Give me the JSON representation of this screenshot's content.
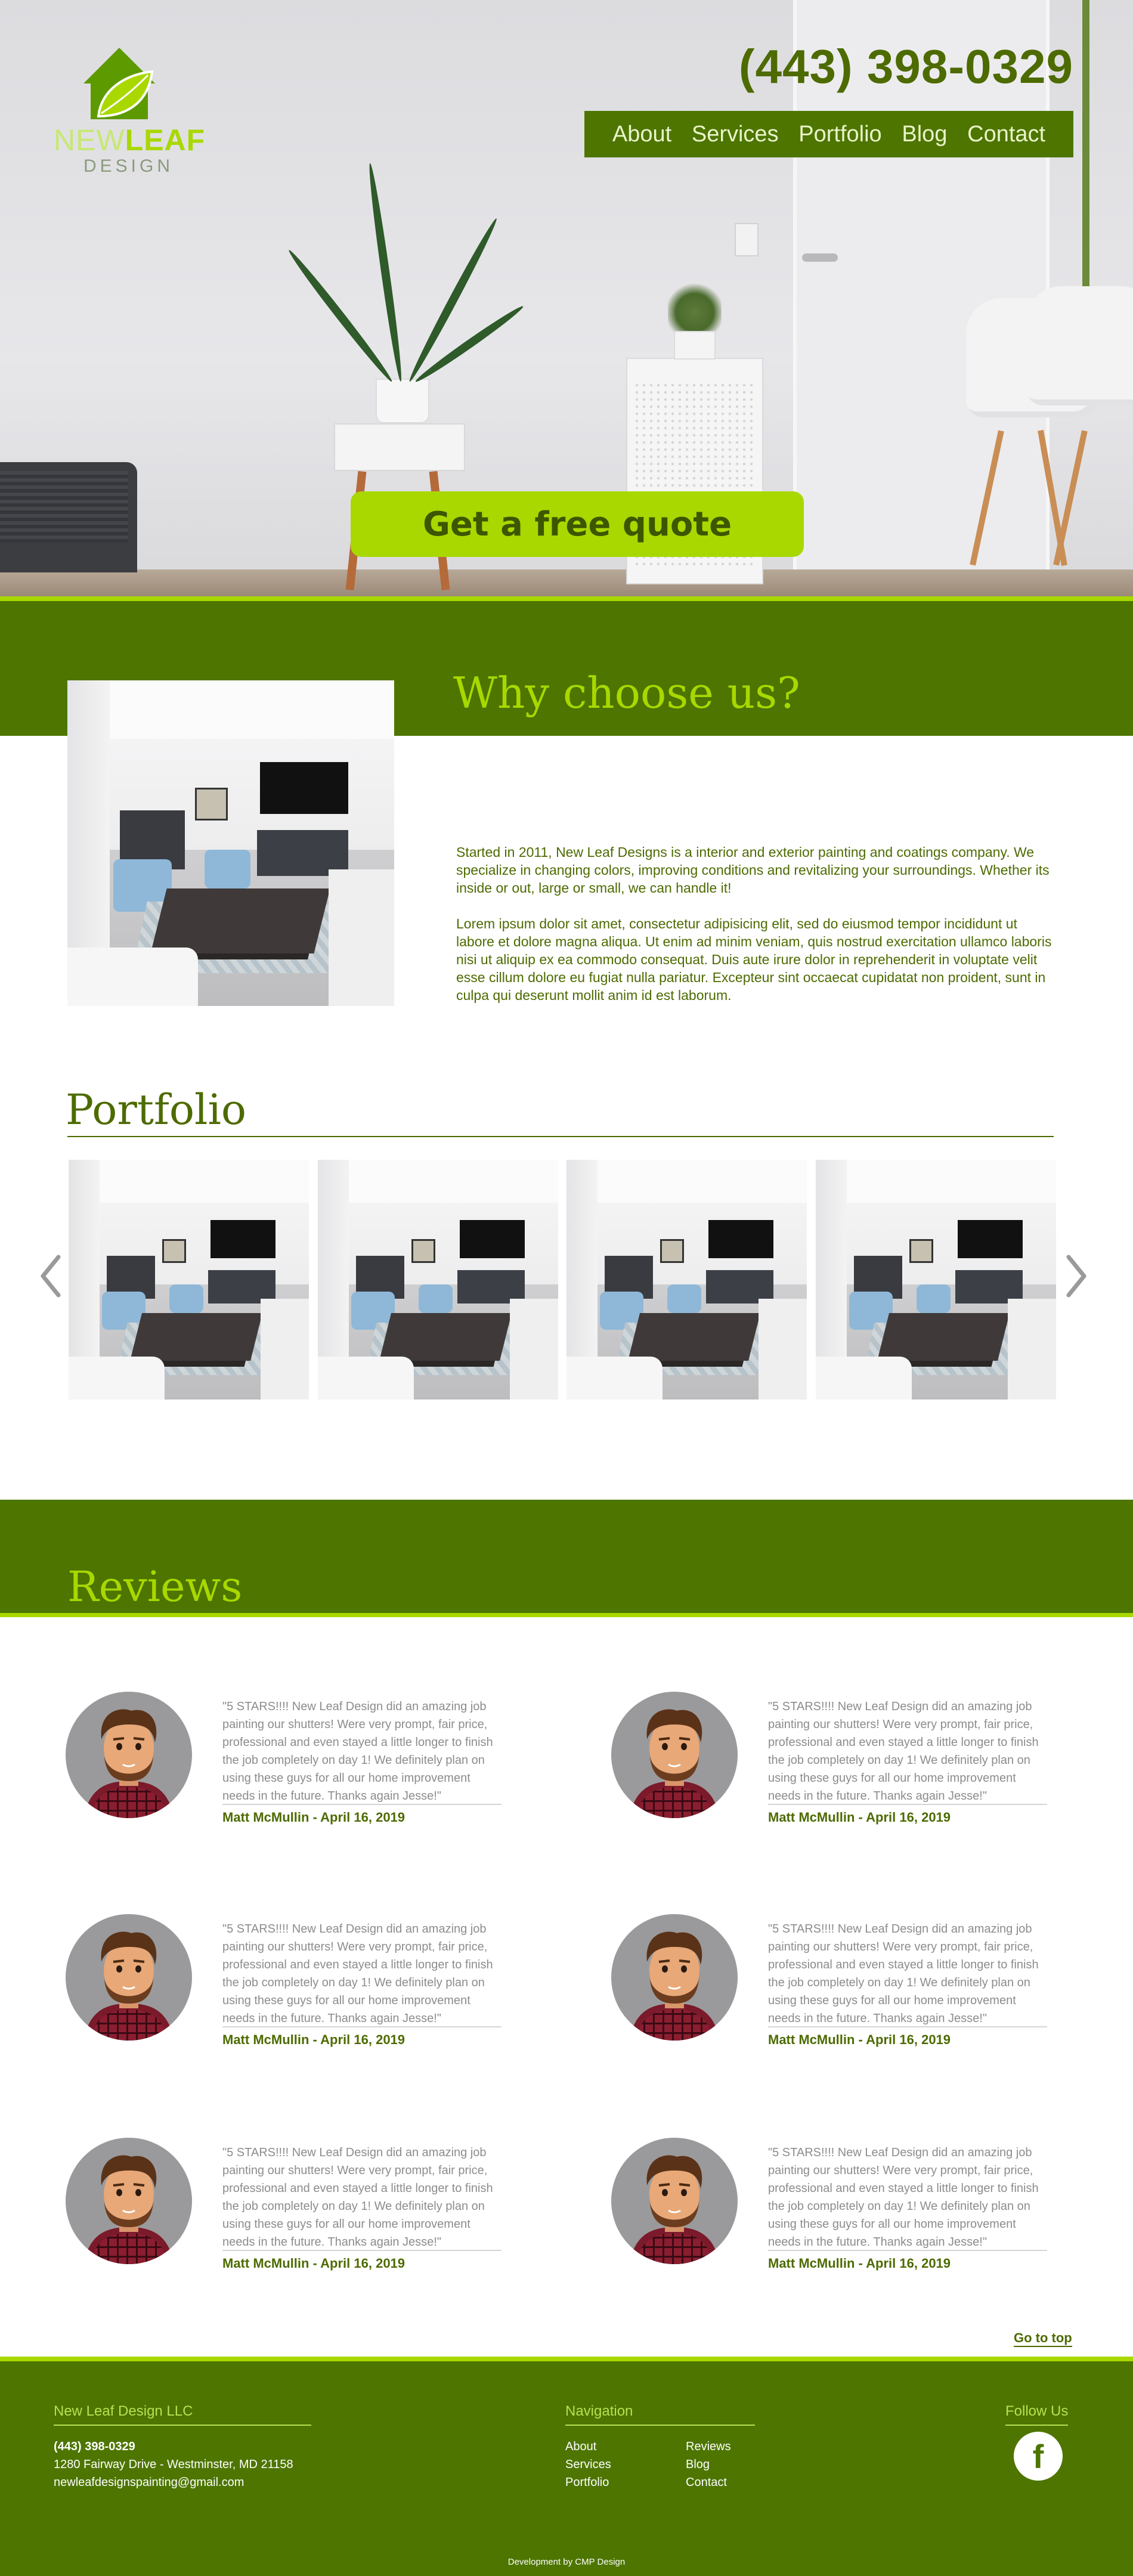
{
  "brand": {
    "logo_light": "NEW",
    "logo_bold": "LEAF",
    "logo_sub": "DESIGN",
    "phone": "(443) 398-0329",
    "accent": "#a8d800",
    "primary": "#4d7500"
  },
  "nav": {
    "items": [
      "About",
      "Services",
      "Portfolio",
      "Blog",
      "Contact"
    ]
  },
  "hero": {
    "cta_label": "Get a free quote"
  },
  "why": {
    "title": "Why choose us?",
    "p1": "Started in 2011, New Leaf Designs is a interior and exterior painting and coatings company. We specialize in changing colors, improving conditions and revitalizing your surroundings. Whether its inside or out, large or small, we can handle it!",
    "p2": "Lorem ipsum dolor sit amet, consectetur adipisicing elit, sed do eiusmod tempor incididunt ut labore et dolore magna aliqua. Ut enim ad minim veniam, quis nostrud exercitation ullamco laboris nisi ut aliquip ex ea commodo consequat. Duis aute irure dolor in reprehenderit in voluptate velit esse cillum dolore eu fugiat nulla pariatur. Excepteur sint occaecat cupidatat non proident, sunt in culpa qui deserunt mollit anim id est laborum."
  },
  "portfolio": {
    "title": "Portfolio",
    "prev_icon": "chevron-left-icon",
    "next_icon": "chevron-right-icon"
  },
  "reviews": {
    "title": "Reviews",
    "items": [
      {
        "text": "\"5 STARS!!!! New Leaf Design did an amazing job painting our shutters! Were very prompt, fair price, professional and even stayed a little longer to finish the job completely on day 1! We definitely plan on using these guys for all our home improvement needs in the future. Thanks again Jesse!\"",
        "author": "Matt McMullin - April 16, 2019"
      },
      {
        "text": "\"5 STARS!!!! New Leaf Design did an amazing job painting our shutters! Were very prompt, fair price, professional and even stayed a little longer to finish the job completely on day 1! We definitely plan on using these guys for all our home improvement needs in the future. Thanks again Jesse!\"",
        "author": "Matt McMullin - April 16, 2019"
      },
      {
        "text": "\"5 STARS!!!! New Leaf Design did an amazing job painting our shutters! Were very prompt, fair price, professional and even stayed a little longer to finish the job completely on day 1! We definitely plan on using these guys for all our home improvement needs in the future. Thanks again Jesse!\"",
        "author": "Matt McMullin - April 16, 2019"
      },
      {
        "text": "\"5 STARS!!!! New Leaf Design did an amazing job painting our shutters! Were very prompt, fair price, professional and even stayed a little longer to finish the job completely on day 1! We definitely plan on using these guys for all our home improvement needs in the future. Thanks again Jesse!\"",
        "author": "Matt McMullin - April 16, 2019"
      },
      {
        "text": "\"5 STARS!!!! New Leaf Design did an amazing job painting our shutters! Were very prompt, fair price, professional and even stayed a little longer to finish the job completely on day 1! We definitely plan on using these guys for all our home improvement needs in the future. Thanks again Jesse!\"",
        "author": "Matt McMullin - April 16, 2019"
      },
      {
        "text": "\"5 STARS!!!! New Leaf Design did an amazing job painting our shutters! Were very prompt, fair price, professional and even stayed a little longer to finish the job completely on day 1! We definitely plan on using these guys for all our home improvement needs in the future. Thanks again Jesse!\"",
        "author": "Matt McMullin - April 16, 2019"
      }
    ]
  },
  "goto_top": "Go to top",
  "footer": {
    "company_heading": "New Leaf Design LLC",
    "phone": "(443) 398-0329",
    "address": "1280 Fairway Drive - Westminster, MD 21158",
    "email": "newleafdesignspainting@gmail.com",
    "nav_heading": "Navigation",
    "nav_col1": [
      "About",
      "Services",
      "Portfolio"
    ],
    "nav_col2": [
      "Reviews",
      "Blog",
      "Contact"
    ],
    "follow_heading": "Follow Us",
    "facebook_icon": "facebook-icon",
    "facebook_glyph": "f",
    "credit": "Development by CMP Design"
  }
}
